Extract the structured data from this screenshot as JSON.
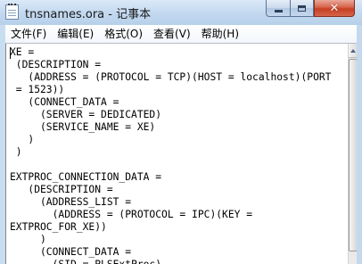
{
  "window": {
    "title": "tnsnames.ora - 记事本",
    "icon": "notepad-icon"
  },
  "caption_buttons": {
    "minimize_icon": "minimize-icon",
    "maximize_icon": "maximize-icon",
    "close_icon": "close-icon",
    "close_glyph": "✕"
  },
  "menu": {
    "items": [
      {
        "label": "文件(F)"
      },
      {
        "label": "编辑(E)"
      },
      {
        "label": "格式(O)"
      },
      {
        "label": "查看(V)"
      },
      {
        "label": "帮助(H)"
      }
    ]
  },
  "editor": {
    "content": "XE =\n (DESCRIPTION =\n   (ADDRESS = (PROTOCOL = TCP)(HOST = localhost)(PORT\n = 1523))\n   (CONNECT_DATA =\n     (SERVER = DEDICATED)\n     (SERVICE_NAME = XE)\n   )\n )\n\nEXTPROC_CONNECTION_DATA =\n   (DESCRIPTION =\n     (ADDRESS_LIST =\n       (ADDRESS = (PROTOCOL = IPC)(KEY =\nEXTPROC_FOR_XE))\n     )\n     (CONNECT_DATA =\n       (SID = PLSExtProc)"
  }
}
